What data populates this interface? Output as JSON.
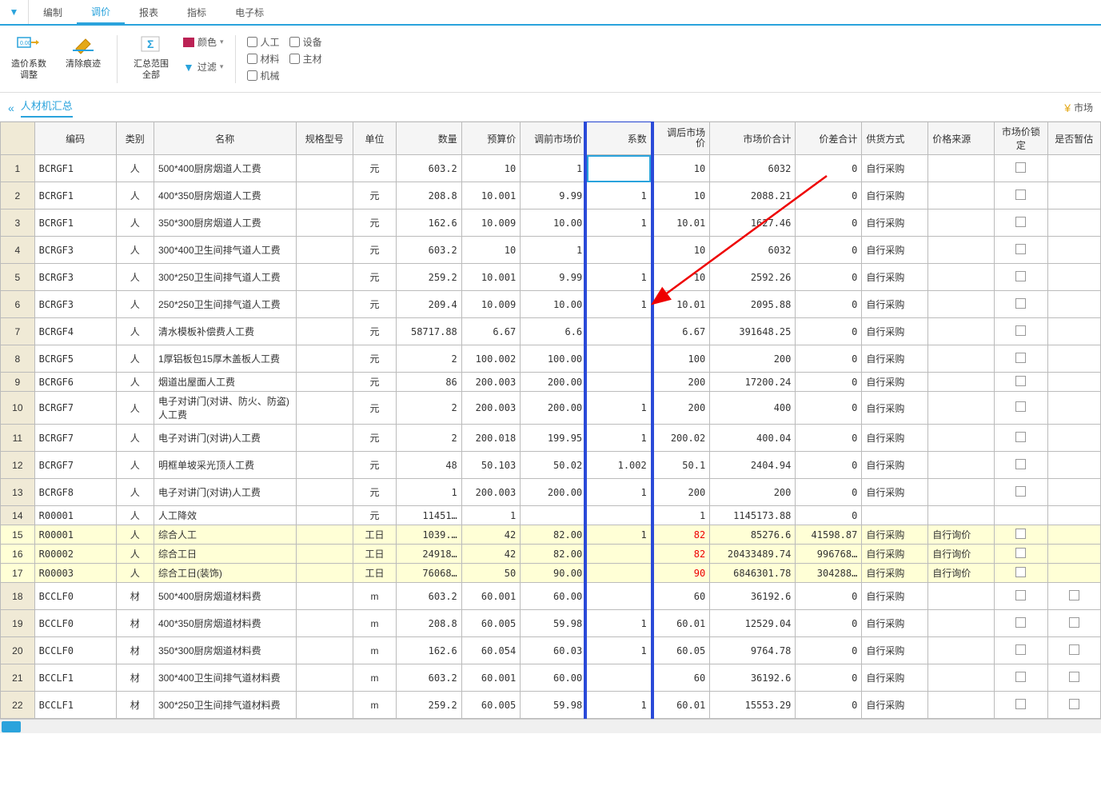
{
  "tabs": [
    "编制",
    "调价",
    "报表",
    "指标",
    "电子标"
  ],
  "active_tab_index": 1,
  "ribbon": {
    "btn1": {
      "label": "造价系数\n调整"
    },
    "btn2": {
      "label": "清除痕迹"
    },
    "btn3": {
      "label": "汇总范围\n全部"
    },
    "color_label": "颜色",
    "filter_label": "过滤",
    "chk_labor": "人工",
    "chk_material": "材料",
    "chk_machine": "机械",
    "chk_equip": "设备",
    "chk_main": "主材"
  },
  "panel_title": "人材机汇总",
  "right_corner": "市场",
  "headers": {
    "rownum": "",
    "code": "编码",
    "cat": "类别",
    "name": "名称",
    "spec": "规格型号",
    "unit": "单位",
    "qty": "数量",
    "budget": "预算价",
    "before": "调前市场价",
    "coef": "系数",
    "after": "调后市场\n价",
    "marketsum": "市场价合计",
    "diff": "价差合计",
    "supply": "供货方式",
    "source": "价格来源",
    "lock": "市场价锁定",
    "temp": "是否暂估"
  },
  "rows": [
    {
      "n": 1,
      "code": "BCRGF1",
      "cat": "人",
      "name": "500*400厨房烟道人工费",
      "unit": "元",
      "qty": "603.2",
      "budget": "10",
      "before": "1",
      "coef": "",
      "after": "10",
      "msum": "6032",
      "diff": "0",
      "supply": "自行采购",
      "source": "",
      "lock": true,
      "active_coef": true
    },
    {
      "n": 2,
      "code": "BCRGF1",
      "cat": "人",
      "name": "400*350厨房烟道人工费",
      "unit": "元",
      "qty": "208.8",
      "budget": "10.001",
      "before": "9.99",
      "coef": "1",
      "after": "10",
      "msum": "2088.21",
      "diff": "0",
      "supply": "自行采购",
      "source": "",
      "lock": true
    },
    {
      "n": 3,
      "code": "BCRGF1",
      "cat": "人",
      "name": "350*300厨房烟道人工费",
      "unit": "元",
      "qty": "162.6",
      "budget": "10.009",
      "before": "10.00",
      "coef": "1",
      "after": "10.01",
      "msum": "1627.46",
      "diff": "0",
      "supply": "自行采购",
      "source": "",
      "lock": true
    },
    {
      "n": 4,
      "code": "BCRGF3",
      "cat": "人",
      "name": "300*400卫生间排气道人工费",
      "unit": "元",
      "qty": "603.2",
      "budget": "10",
      "before": "1",
      "coef": "",
      "after": "10",
      "msum": "6032",
      "diff": "0",
      "supply": "自行采购",
      "source": "",
      "lock": true
    },
    {
      "n": 5,
      "code": "BCRGF3",
      "cat": "人",
      "name": "300*250卫生间排气道人工费",
      "unit": "元",
      "qty": "259.2",
      "budget": "10.001",
      "before": "9.99",
      "coef": "1",
      "after": "10",
      "msum": "2592.26",
      "diff": "0",
      "supply": "自行采购",
      "source": "",
      "lock": true
    },
    {
      "n": 6,
      "code": "BCRGF3",
      "cat": "人",
      "name": "250*250卫生间排气道人工费",
      "unit": "元",
      "qty": "209.4",
      "budget": "10.009",
      "before": "10.00",
      "coef": "1",
      "after": "10.01",
      "msum": "2095.88",
      "diff": "0",
      "supply": "自行采购",
      "source": "",
      "lock": true
    },
    {
      "n": 7,
      "code": "BCRGF4",
      "cat": "人",
      "name": "清水模板补偿费人工费",
      "unit": "元",
      "qty": "58717.88",
      "budget": "6.67",
      "before": "6.6",
      "coef": "",
      "after": "6.67",
      "msum": "391648.25",
      "diff": "0",
      "supply": "自行采购",
      "source": "",
      "lock": true
    },
    {
      "n": 8,
      "code": "BCRGF5",
      "cat": "人",
      "name": "1厚铝板包15厚木盖板人工费",
      "unit": "元",
      "qty": "2",
      "budget": "100.002",
      "before": "100.00",
      "coef": "",
      "after": "100",
      "msum": "200",
      "diff": "0",
      "supply": "自行采购",
      "source": "",
      "lock": true
    },
    {
      "n": 9,
      "code": "BCRGF6",
      "cat": "人",
      "name": "烟道出屋面人工费",
      "unit": "元",
      "qty": "86",
      "budget": "200.003",
      "before": "200.00",
      "coef": "",
      "after": "200",
      "msum": "17200.24",
      "diff": "0",
      "supply": "自行采购",
      "source": "",
      "lock": true,
      "short": true
    },
    {
      "n": 10,
      "code": "BCRGF7",
      "cat": "人",
      "name": "电子对讲门(对讲、防火、防盗)人工费",
      "unit": "元",
      "qty": "2",
      "budget": "200.003",
      "before": "200.00",
      "coef": "1",
      "after": "200",
      "msum": "400",
      "diff": "0",
      "supply": "自行采购",
      "source": "",
      "lock": true
    },
    {
      "n": 11,
      "code": "BCRGF7",
      "cat": "人",
      "name": "电子对讲门(对讲)人工费",
      "unit": "元",
      "qty": "2",
      "budget": "200.018",
      "before": "199.95",
      "coef": "1",
      "after": "200.02",
      "msum": "400.04",
      "diff": "0",
      "supply": "自行采购",
      "source": "",
      "lock": true
    },
    {
      "n": 12,
      "code": "BCRGF7",
      "cat": "人",
      "name": "明框单坡采光顶人工费",
      "unit": "元",
      "qty": "48",
      "budget": "50.103",
      "before": "50.02",
      "coef": "1.002",
      "after": "50.1",
      "msum": "2404.94",
      "diff": "0",
      "supply": "自行采购",
      "source": "",
      "lock": true
    },
    {
      "n": 13,
      "code": "BCRGF8",
      "cat": "人",
      "name": "电子对讲门(对讲)人工费",
      "unit": "元",
      "qty": "1",
      "budget": "200.003",
      "before": "200.00",
      "coef": "1",
      "after": "200",
      "msum": "200",
      "diff": "0",
      "supply": "自行采购",
      "source": "",
      "lock": true
    },
    {
      "n": 14,
      "code": "R00001",
      "cat": "人",
      "name": "人工降效",
      "unit": "元",
      "qty": "11451…",
      "budget": "1",
      "before": "",
      "coef": "",
      "after": "1",
      "msum": "1145173.88",
      "diff": "0",
      "supply": "",
      "source": "",
      "lock": false,
      "short": true
    },
    {
      "n": 15,
      "code": "R00001",
      "cat": "人",
      "name": "综合人工",
      "unit": "工日",
      "qty": "1039.…",
      "budget": "42",
      "before": "82.00",
      "coef": "1",
      "after": "82",
      "msum": "85276.6",
      "diff": "41598.87",
      "supply": "自行采购",
      "source": "自行询价",
      "lock": true,
      "short": true,
      "hl": true,
      "red": true
    },
    {
      "n": 16,
      "code": "R00002",
      "cat": "人",
      "name": "综合工日",
      "unit": "工日",
      "qty": "24918…",
      "budget": "42",
      "before": "82.00",
      "coef": "",
      "after": "82",
      "msum": "20433489.74",
      "diff": "996768…",
      "supply": "自行采购",
      "source": "自行询价",
      "lock": true,
      "short": true,
      "hl": true,
      "red": true
    },
    {
      "n": 17,
      "code": "R00003",
      "cat": "人",
      "name": "综合工日(装饰)",
      "unit": "工日",
      "qty": "76068…",
      "budget": "50",
      "before": "90.00",
      "coef": "",
      "after": "90",
      "msum": "6846301.78",
      "diff": "304288…",
      "supply": "自行采购",
      "source": "自行询价",
      "lock": true,
      "short": true,
      "hl": true,
      "red": true
    },
    {
      "n": 18,
      "code": "BCCLF0",
      "cat": "材",
      "name": "500*400厨房烟道材料费",
      "unit": "m",
      "qty": "603.2",
      "budget": "60.001",
      "before": "60.00",
      "coef": "",
      "after": "60",
      "msum": "36192.6",
      "diff": "0",
      "supply": "自行采购",
      "source": "",
      "lock": true,
      "temp": true
    },
    {
      "n": 19,
      "code": "BCCLF0",
      "cat": "材",
      "name": "400*350厨房烟道材料费",
      "unit": "m",
      "qty": "208.8",
      "budget": "60.005",
      "before": "59.98",
      "coef": "1",
      "after": "60.01",
      "msum": "12529.04",
      "diff": "0",
      "supply": "自行采购",
      "source": "",
      "lock": true,
      "temp": true
    },
    {
      "n": 20,
      "code": "BCCLF0",
      "cat": "材",
      "name": "350*300厨房烟道材料费",
      "unit": "m",
      "qty": "162.6",
      "budget": "60.054",
      "before": "60.03",
      "coef": "1",
      "after": "60.05",
      "msum": "9764.78",
      "diff": "0",
      "supply": "自行采购",
      "source": "",
      "lock": true,
      "temp": true
    },
    {
      "n": 21,
      "code": "BCCLF1",
      "cat": "材",
      "name": "300*400卫生间排气道材料费",
      "unit": "m",
      "qty": "603.2",
      "budget": "60.001",
      "before": "60.00",
      "coef": "",
      "after": "60",
      "msum": "36192.6",
      "diff": "0",
      "supply": "自行采购",
      "source": "",
      "lock": true,
      "temp": true
    },
    {
      "n": 22,
      "code": "BCCLF1",
      "cat": "材",
      "name": "300*250卫生间排气道材料费",
      "unit": "m",
      "qty": "259.2",
      "budget": "60.005",
      "before": "59.98",
      "coef": "1",
      "after": "60.01",
      "msum": "15553.29",
      "diff": "0",
      "supply": "自行采购",
      "source": "",
      "lock": true,
      "temp": true
    }
  ]
}
